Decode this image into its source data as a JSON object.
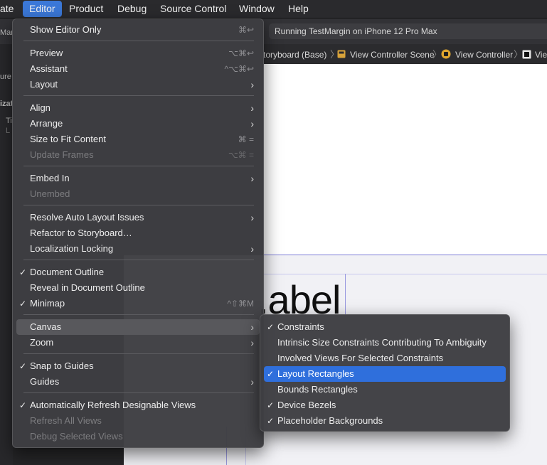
{
  "menubar": {
    "items": [
      {
        "label": "ate"
      },
      {
        "label": "Editor"
      },
      {
        "label": "Product"
      },
      {
        "label": "Debug"
      },
      {
        "label": "Source Control"
      },
      {
        "label": "Window"
      },
      {
        "label": "Help"
      }
    ]
  },
  "toolbar": {
    "status": "Running TestMargin on iPhone 12 Pro Max"
  },
  "left_pane": {
    "fragments": [
      "Mar",
      "ure",
      "izat",
      "Ti",
      "L"
    ]
  },
  "jumpbar": {
    "items": [
      {
        "label": "toryboard (Base)"
      },
      {
        "label": "View Controller Scene"
      },
      {
        "label": "View Controller"
      },
      {
        "label": "Vie"
      }
    ]
  },
  "canvas": {
    "label_text": ".abel"
  },
  "editor_menu": {
    "items": [
      {
        "label": "Show Editor Only",
        "shortcut": "⌘↩"
      },
      {
        "label": "Preview",
        "shortcut": "⌥⌘↩"
      },
      {
        "label": "Assistant",
        "shortcut": "^⌥⌘↩"
      },
      {
        "label": "Layout",
        "submenu": "›"
      },
      {
        "label": "Align",
        "submenu": "›"
      },
      {
        "label": "Arrange",
        "submenu": "›"
      },
      {
        "label": "Size to Fit Content",
        "shortcut": "⌘ ="
      },
      {
        "label": "Update Frames",
        "shortcut": "⌥⌘ ="
      },
      {
        "label": "Embed In",
        "submenu": "›"
      },
      {
        "label": "Unembed"
      },
      {
        "label": "Resolve Auto Layout Issues",
        "submenu": "›"
      },
      {
        "label": "Refactor to Storyboard…"
      },
      {
        "label": "Localization Locking",
        "submenu": "›"
      },
      {
        "label": "Document Outline",
        "check": "✓"
      },
      {
        "label": "Reveal in Document Outline"
      },
      {
        "label": "Minimap",
        "check": "✓",
        "shortcut": "^⇧⌘M"
      },
      {
        "label": "Canvas",
        "submenu": "›"
      },
      {
        "label": "Zoom",
        "submenu": "›"
      },
      {
        "label": "Snap to Guides",
        "check": "✓"
      },
      {
        "label": "Guides",
        "submenu": "›"
      },
      {
        "label": "Automatically Refresh Designable Views",
        "check": "✓"
      },
      {
        "label": "Refresh All Views"
      },
      {
        "label": "Debug Selected Views"
      }
    ]
  },
  "canvas_menu": {
    "items": [
      {
        "label": "Constraints",
        "check": "✓"
      },
      {
        "label": "Intrinsic Size Constraints Contributing To Ambiguity"
      },
      {
        "label": "Involved Views For Selected Constraints"
      },
      {
        "label": "Layout Rectangles",
        "check": "✓"
      },
      {
        "label": "Bounds Rectangles"
      },
      {
        "label": "Device Bezels",
        "check": "✓"
      },
      {
        "label": "Placeholder Backgrounds",
        "check": "✓"
      }
    ]
  }
}
